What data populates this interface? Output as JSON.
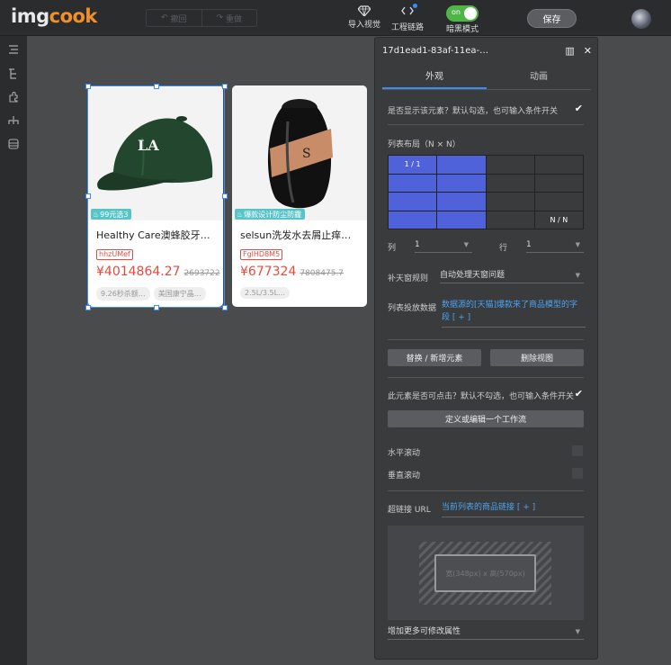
{
  "app": {
    "logo_a": "img",
    "logo_b": "cook"
  },
  "topbar": {
    "undo_label": "撤回",
    "redo_label": "重做",
    "visual_label": "导入视觉",
    "engineering_label": "工程链路",
    "dark_toggle": "on",
    "dark_label": "暗黑模式",
    "save_label": "保存"
  },
  "cards": [
    {
      "badge": "99元选3",
      "title": "Healthy Care澳蜂胶牙…",
      "code": "hhzUMef",
      "price": "¥4014864.27",
      "orig_price": "2693722",
      "tags": [
        "9.26秒杀额…",
        "美国康宁晶…"
      ]
    },
    {
      "badge": "爆款设计防尘防霾",
      "title": "selsun洗发水去屑止痒…",
      "code": "FglHD8M5",
      "price": "¥677324",
      "orig_price": "7808475.7",
      "tags": [
        "2.5L/3.5L…"
      ]
    }
  ],
  "panel": {
    "title": "17d1ead1-83af-11ea-…",
    "tabs": [
      "外观",
      "动画"
    ],
    "show_label": "是否显示该元素？默认勾选，也可输入条件开关",
    "layout_label": "列表布局（N × N）",
    "grid_first": "1 / 1",
    "grid_last": "N / N",
    "col_label": "列",
    "col_value": "1",
    "row_label": "行",
    "row_value": "1",
    "fill_label": "补天窗规则",
    "fill_value": "自动处理天窗问题",
    "data_label": "列表投放数据",
    "data_value": "数据源的[天猫]爆款来了商品模型的字段 [ + ]",
    "replace_button": "替换 / 新增元素",
    "delete_button": "删除视图",
    "click_label": "此元素是否可点击？默认不勾选，也可输入条件开关",
    "workflow_button": "定义或编辑一个工作流",
    "h_scroll": "水平滚动",
    "v_scroll": "垂直滚动",
    "url_label": "超链接 URL",
    "url_value": "当前列表的商品链接 [ + ]",
    "drop_text": "宽(348px) x 高(570px)",
    "more_props": "增加更多可修改属性"
  }
}
